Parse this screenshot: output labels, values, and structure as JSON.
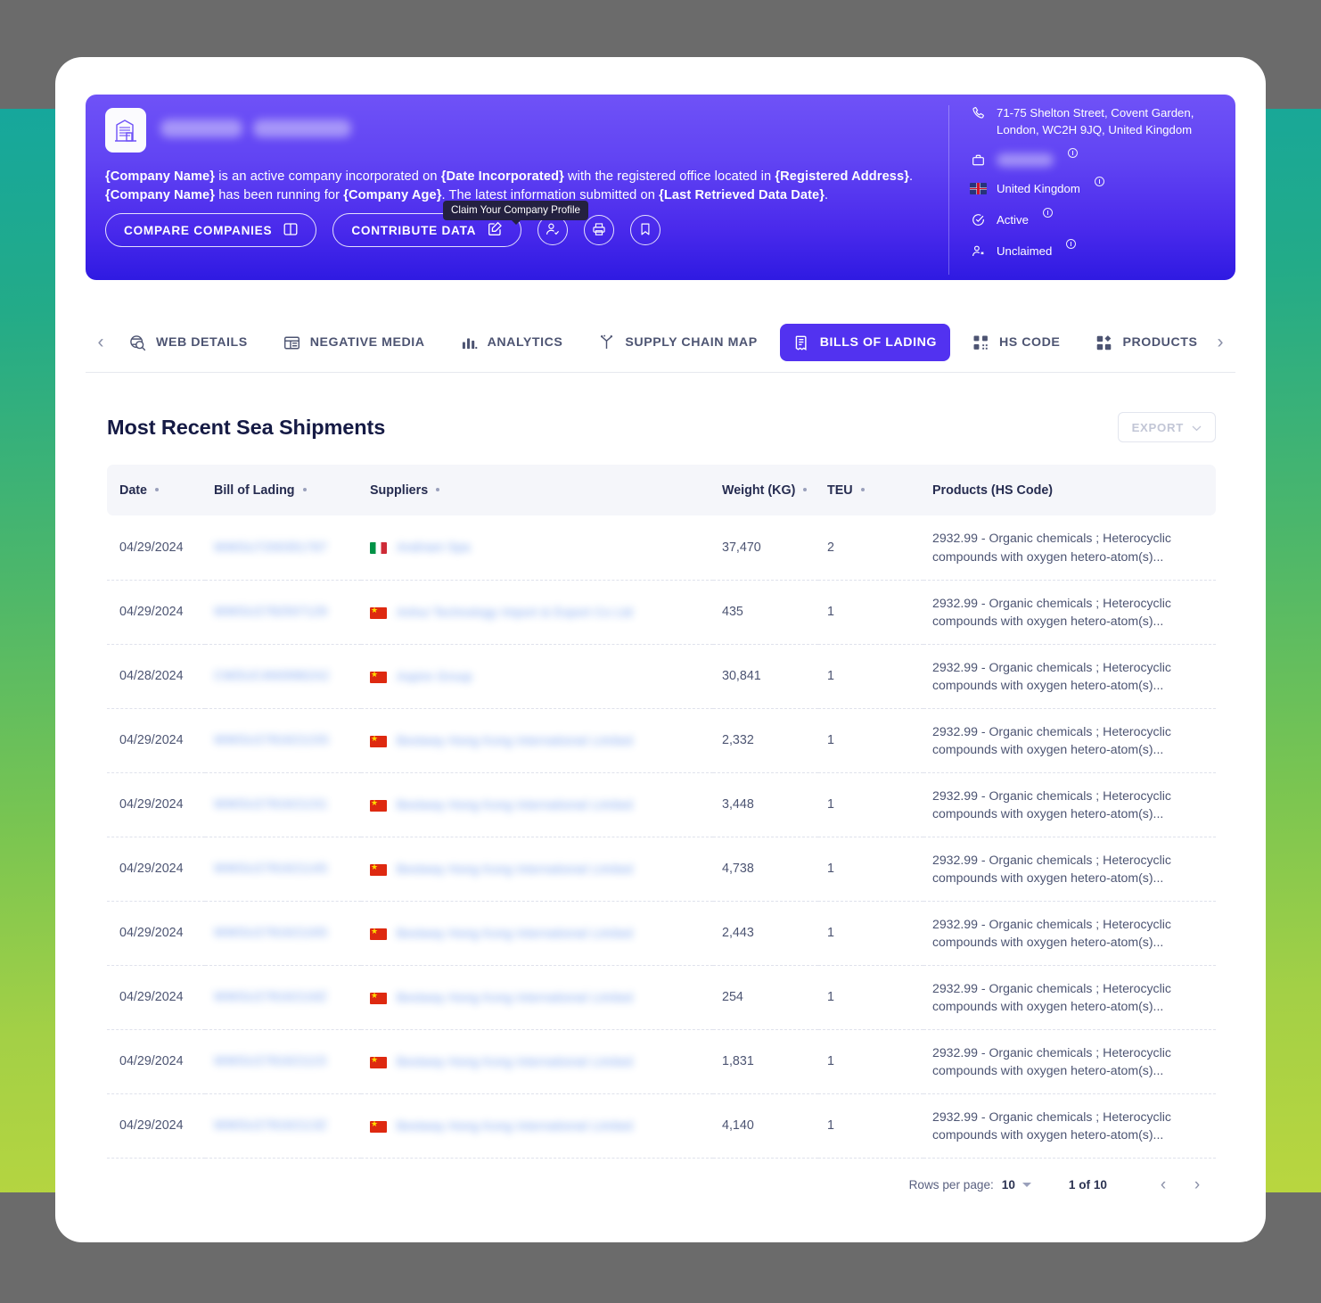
{
  "banner": {
    "company_name_redacted": true,
    "description_parts": [
      {
        "t": "{Company Name}",
        "b": true
      },
      {
        "t": " is an active company incorporated on ",
        "b": false
      },
      {
        "t": "{Date Incorporated}",
        "b": true
      },
      {
        "t": " with the registered office located in ",
        "b": false
      },
      {
        "t": "{Registered Address}",
        "b": true
      },
      {
        "t": ". ",
        "b": false
      },
      {
        "t": "{Company Name}",
        "b": true
      },
      {
        "t": " has been running for ",
        "b": false
      },
      {
        "t": "{Company Age}",
        "b": true
      },
      {
        "t": ". The latest information submitted on ",
        "b": false
      },
      {
        "t": "{Last Retrieved Data Date}",
        "b": true
      },
      {
        "t": ".",
        "b": false
      }
    ],
    "compare_label": "COMPARE COMPANIES",
    "contribute_label": "CONTRIBUTE DATA",
    "tooltip": "Claim Your Company Profile",
    "meta": {
      "address": "71-75 Shelton Street, Covent Garden, London, WC2H 9JQ, United Kingdom",
      "industry_redacted": true,
      "country": "United Kingdom",
      "status": "Active",
      "claim_status": "Unclaimed"
    },
    "accent_bg_top": "#6f52f7",
    "accent_bg_bottom": "#2f1ae2"
  },
  "nav": {
    "prev_arrow": "‹",
    "next_arrow": "›",
    "tabs": [
      {
        "label": "WEB DETAILS",
        "icon": "web-search-icon",
        "active": false
      },
      {
        "label": "NEGATIVE MEDIA",
        "icon": "news-layout-icon",
        "active": false
      },
      {
        "label": "ANALYTICS",
        "icon": "bar-chart-icon",
        "active": false
      },
      {
        "label": "SUPPLY CHAIN MAP",
        "icon": "supply-chain-icon",
        "active": false
      },
      {
        "label": "BILLS OF LADING",
        "icon": "document-list-icon",
        "active": true
      },
      {
        "label": "HS CODE",
        "icon": "qr-code-icon",
        "active": false
      },
      {
        "label": "PRODUCTS",
        "icon": "products-grid-icon",
        "active": false
      }
    ],
    "active_color": "#5232f0"
  },
  "section": {
    "title": "Most Recent Sea Shipments",
    "export_label": "EXPORT"
  },
  "table": {
    "columns": [
      {
        "label": "Date",
        "sortable": true
      },
      {
        "label": "Bill of Lading",
        "sortable": true
      },
      {
        "label": "Suppliers",
        "sortable": true
      },
      {
        "label": "Weight (KG)",
        "sortable": true
      },
      {
        "label": "TEU",
        "sortable": true
      },
      {
        "label": "Products (HS Code)",
        "sortable": false
      }
    ],
    "rows": [
      {
        "date": "04/29/2024",
        "bol": "WWGU7200351767",
        "flag": "it",
        "supplier": "Andriani Spa",
        "weight": "37,470",
        "teu": "2",
        "products": "2932.99 - Organic chemicals ; Heterocyclic compounds with oxygen hetero-atom(s)..."
      },
      {
        "date": "04/29/2024",
        "bol": "WWGU2782507129",
        "flag": "cn",
        "supplier": "Anhui Technology Import & Export Co Ltd",
        "weight": "435",
        "teu": "1",
        "products": "2932.99 - Organic chemicals ; Heterocyclic compounds with oxygen hetero-atom(s)..."
      },
      {
        "date": "04/28/2024",
        "bol": "CWDUC4N09962A2",
        "flag": "cn",
        "supplier": "Aspire Group",
        "weight": "30,841",
        "teu": "1",
        "products": "2932.99 - Organic chemicals ; Heterocyclic compounds with oxygen hetero-atom(s)..."
      },
      {
        "date": "04/29/2024",
        "bol": "WWGU27816211SS",
        "flag": "cn",
        "supplier": "Bestway Hong Kong International Limited",
        "weight": "2,332",
        "teu": "1",
        "products": "2932.99 - Organic chemicals ; Heterocyclic compounds with oxygen hetero-atom(s)..."
      },
      {
        "date": "04/29/2024",
        "bol": "WWGU27816211S1",
        "flag": "cn",
        "supplier": "Bestway Hong Kong International Limited",
        "weight": "3,448",
        "teu": "1",
        "products": "2932.99 - Organic chemicals ; Heterocyclic compounds with oxygen hetero-atom(s)..."
      },
      {
        "date": "04/29/2024",
        "bol": "WWGU278162114S",
        "flag": "cn",
        "supplier": "Bestway Hong Kong International Limited",
        "weight": "4,738",
        "teu": "1",
        "products": "2932.99 - Organic chemicals ; Heterocyclic compounds with oxygen hetero-atom(s)..."
      },
      {
        "date": "04/29/2024",
        "bol": "WWGU278162116S",
        "flag": "cn",
        "supplier": "Bestway Hong Kong International Limited",
        "weight": "2,443",
        "teu": "1",
        "products": "2932.99 - Organic chemicals ; Heterocyclic compounds with oxygen hetero-atom(s)..."
      },
      {
        "date": "04/29/2024",
        "bol": "WWGU278162116Z",
        "flag": "cn",
        "supplier": "Bestway Hong Kong International Limited",
        "weight": "254",
        "teu": "1",
        "products": "2932.99 - Organic chemicals ; Heterocyclic compounds with oxygen hetero-atom(s)..."
      },
      {
        "date": "04/29/2024",
        "bol": "WWGU278162111S",
        "flag": "cn",
        "supplier": "Bestway Hong Kong International Limited",
        "weight": "1,831",
        "teu": "1",
        "products": "2932.99 - Organic chemicals ; Heterocyclic compounds with oxygen hetero-atom(s)..."
      },
      {
        "date": "04/29/2024",
        "bol": "WWGU278162113Z",
        "flag": "cn",
        "supplier": "Bestway Hong Kong International Limited",
        "weight": "4,140",
        "teu": "1",
        "products": "2932.99 - Organic chemicals ; Heterocyclic compounds with oxygen hetero-atom(s)..."
      }
    ]
  },
  "pagination": {
    "rows_per_page_label": "Rows per page:",
    "rows_per_page_value": "10",
    "page_indicator": "1 of 10",
    "prev_arrow": "‹",
    "next_arrow": "›"
  }
}
